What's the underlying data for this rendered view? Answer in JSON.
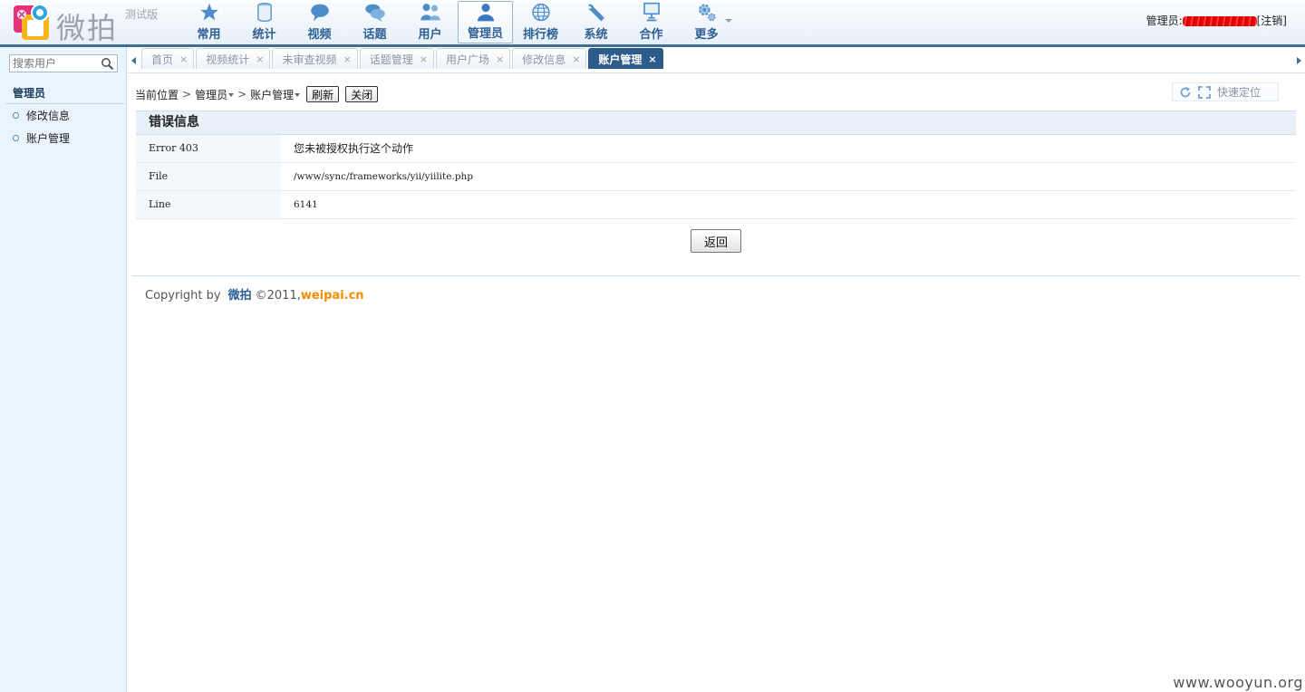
{
  "header": {
    "brand": "微拍",
    "edition": "测试版",
    "nav": [
      {
        "label": "常用",
        "icon": "star-icon"
      },
      {
        "label": "统计",
        "icon": "database-icon"
      },
      {
        "label": "视频",
        "icon": "chat-bubble-icon"
      },
      {
        "label": "话题",
        "icon": "chat-bubbles-icon"
      },
      {
        "label": "用户",
        "icon": "users-icon"
      },
      {
        "label": "管理员",
        "icon": "admin-user-icon",
        "active": true
      },
      {
        "label": "排行榜",
        "icon": "globe-icon"
      },
      {
        "label": "系统",
        "icon": "wrench-icon"
      },
      {
        "label": "合作",
        "icon": "monitor-icon"
      },
      {
        "label": "更多",
        "icon": "gears-icon"
      }
    ],
    "user": {
      "prefix": "管理员:",
      "logout": "[注销]"
    }
  },
  "sidebar": {
    "search_placeholder": "搜索用户",
    "title": "管理员",
    "items": [
      {
        "label": "修改信息"
      },
      {
        "label": "账户管理"
      }
    ]
  },
  "tabs": [
    {
      "label": "首页"
    },
    {
      "label": "视频统计"
    },
    {
      "label": "未审查视频"
    },
    {
      "label": "话题管理"
    },
    {
      "label": "用户广场"
    },
    {
      "label": "修改信息"
    },
    {
      "label": "账户管理",
      "active": true
    }
  ],
  "tab_close_glyph": "×",
  "breadcrumb": {
    "location": "当前位置",
    "sep": ">",
    "level1": "管理员",
    "level2": "账户管理",
    "refresh": "刷新",
    "close": "关闭"
  },
  "quickbar": {
    "label": "快速定位"
  },
  "error": {
    "title": "错误信息",
    "rows": [
      {
        "key": "Error 403",
        "value": "您未被授权执行这个动作"
      },
      {
        "key": "File",
        "value": "/www/sync/frameworks/yii/yiilite.php"
      },
      {
        "key": "Line",
        "value": "6141"
      }
    ],
    "back": "返回"
  },
  "footer": {
    "copyright": "Copyright by",
    "brand": "微拍",
    "year": "©2011,",
    "site": "weipai.cn"
  },
  "watermark": "www.wooyun.org",
  "colors": {
    "accent": "#2c5f93",
    "header_border": "#3f6f94",
    "active_tab": "#2c5c8a",
    "sidebar_bg": "#eaf4fd",
    "footer_site": "#f08c00"
  }
}
